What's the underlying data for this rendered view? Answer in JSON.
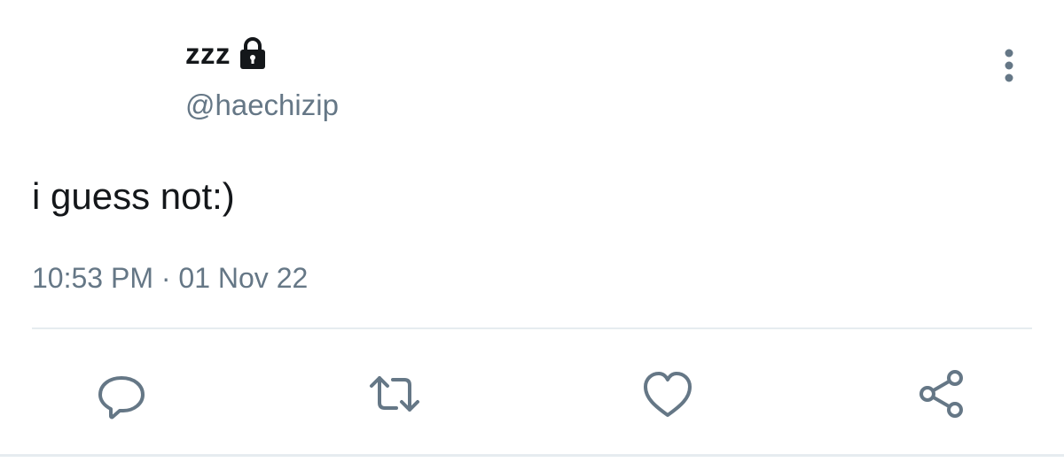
{
  "tweet": {
    "display_name": "zzz",
    "protected_icon": "lock-icon",
    "handle": "@haechizip",
    "text": "i guess not:)",
    "timestamp": "10:53 PM · 01 Nov 22"
  },
  "actions": {
    "reply_icon": "reply-icon",
    "retweet_icon": "retweet-icon",
    "like_icon": "heart-icon",
    "share_icon": "share-icon"
  },
  "menu_icon": "more-vertical-icon",
  "colors": {
    "primary_text": "#14171a",
    "secondary_text": "#657786",
    "divider": "#e6ecf0",
    "icon": "#657786"
  }
}
